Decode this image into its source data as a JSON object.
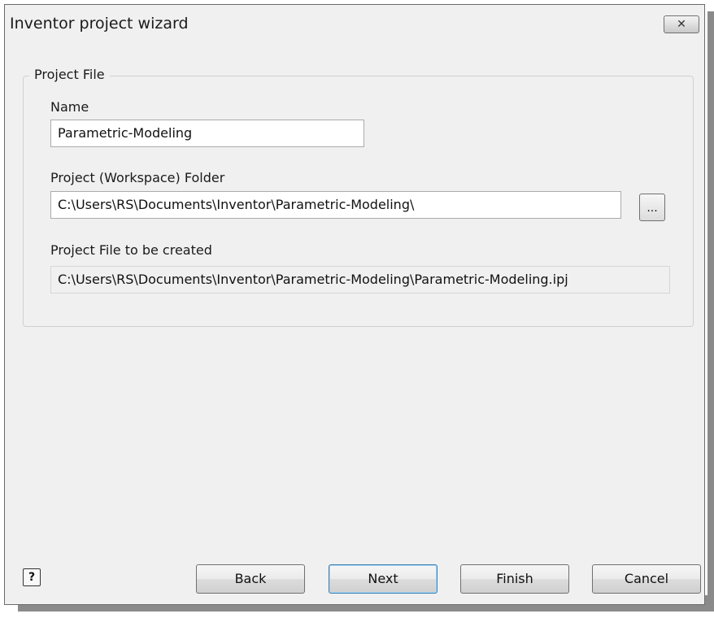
{
  "window": {
    "title": "Inventor project wizard",
    "close_label": "✕"
  },
  "group": {
    "label": "Project File"
  },
  "name_field": {
    "label": "Name",
    "value": "Parametric-Modeling"
  },
  "folder_field": {
    "label": "Project (Workspace) Folder",
    "value": "C:\\Users\\RS\\Documents\\Inventor\\Parametric-Modeling\\",
    "browse_label": "..."
  },
  "created_field": {
    "label": "Project File to be created",
    "value": "C:\\Users\\RS\\Documents\\Inventor\\Parametric-Modeling\\Parametric-Modeling.ipj"
  },
  "footer": {
    "help_label": "?",
    "back_label": "Back",
    "next_label": "Next",
    "finish_label": "Finish",
    "cancel_label": "Cancel"
  }
}
